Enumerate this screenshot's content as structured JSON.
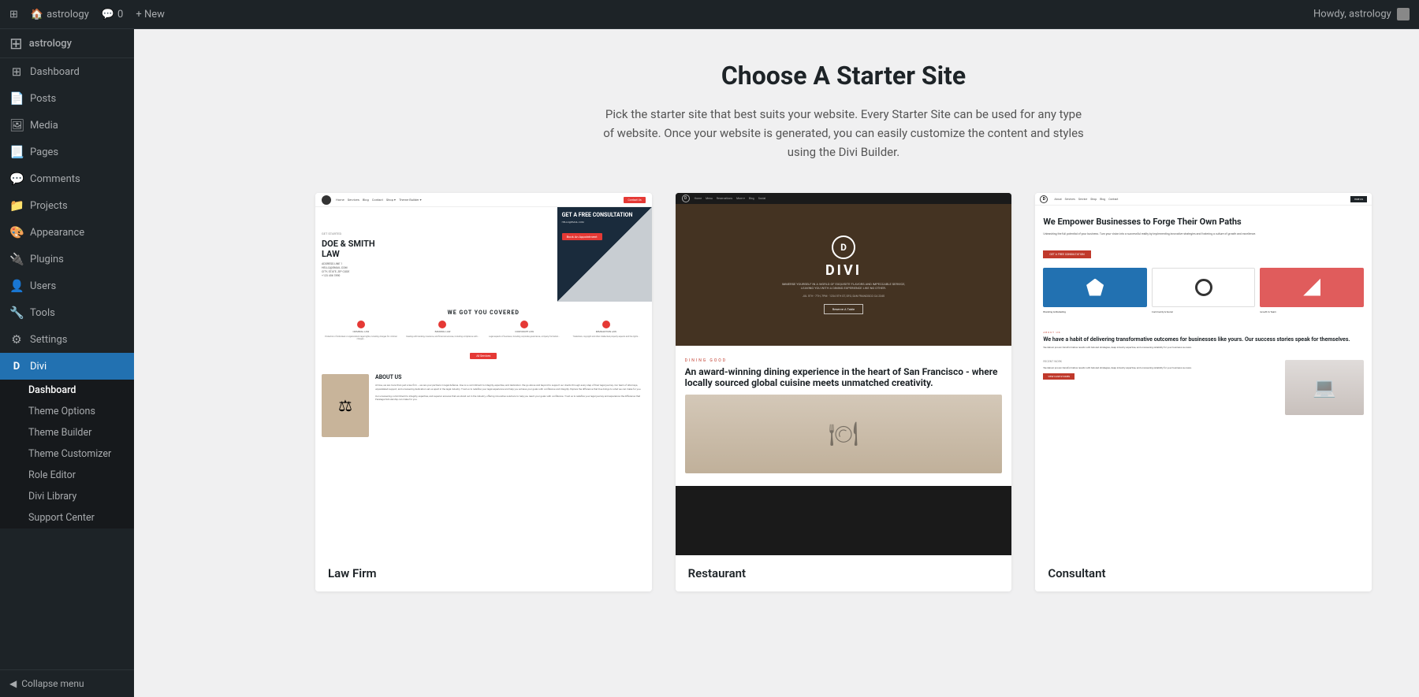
{
  "topbar": {
    "site_name": "astrology",
    "comments_icon": "💬",
    "comments_count": "0",
    "new_label": "+ New",
    "howdy_text": "Howdy, astrology"
  },
  "sidebar": {
    "items": [
      {
        "id": "dashboard",
        "label": "Dashboard",
        "icon": "⊞"
      },
      {
        "id": "posts",
        "label": "Posts",
        "icon": "📄"
      },
      {
        "id": "media",
        "label": "Media",
        "icon": "🖼"
      },
      {
        "id": "pages",
        "label": "Pages",
        "icon": "📃"
      },
      {
        "id": "comments",
        "label": "Comments",
        "icon": "💬"
      },
      {
        "id": "projects",
        "label": "Projects",
        "icon": "📁"
      },
      {
        "id": "appearance",
        "label": "Appearance",
        "icon": "🎨"
      },
      {
        "id": "plugins",
        "label": "Plugins",
        "icon": "🔌"
      },
      {
        "id": "users",
        "label": "Users",
        "icon": "👤"
      },
      {
        "id": "tools",
        "label": "Tools",
        "icon": "🔧"
      },
      {
        "id": "settings",
        "label": "Settings",
        "icon": "⚙"
      }
    ],
    "divi_label": "Divi",
    "divi_submenu": [
      {
        "id": "divi-dashboard",
        "label": "Dashboard"
      },
      {
        "id": "theme-options",
        "label": "Theme Options"
      },
      {
        "id": "theme-builder",
        "label": "Theme Builder"
      },
      {
        "id": "theme-customizer",
        "label": "Theme Customizer"
      },
      {
        "id": "role-editor",
        "label": "Role Editor"
      },
      {
        "id": "divi-library",
        "label": "Divi Library"
      },
      {
        "id": "support-center",
        "label": "Support Center"
      }
    ],
    "collapse_label": "Collapse menu"
  },
  "main": {
    "page_title": "Choose A Starter Site",
    "page_subtitle": "Pick the starter site that best suits your website. Every Starter Site can be used for any type of website. Once your website is generated, you can easily customize the content and styles using the Divi Builder.",
    "starter_sites": [
      {
        "id": "law-firm",
        "label": "Law Firm"
      },
      {
        "id": "restaurant",
        "label": "Restaurant"
      },
      {
        "id": "consultant",
        "label": "Consultant"
      }
    ]
  }
}
